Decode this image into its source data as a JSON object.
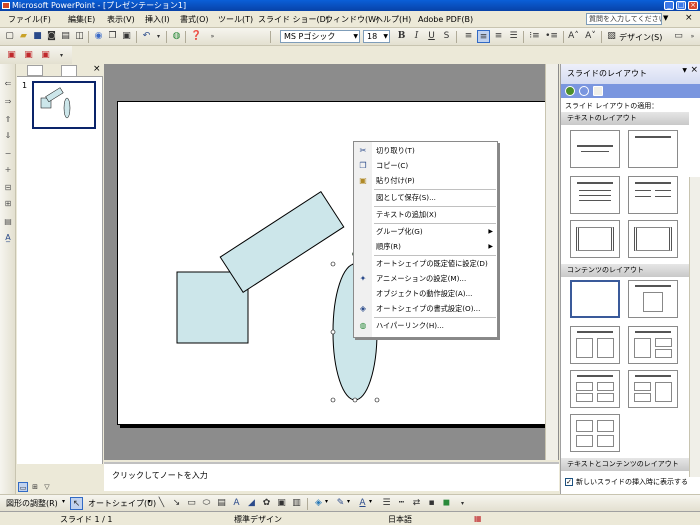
{
  "window": {
    "title": "Microsoft PowerPoint - [プレゼンテーション1]"
  },
  "menu": {
    "items": [
      "ファイル(F)",
      "編集(E)",
      "表示(V)",
      "挿入(I)",
      "書式(O)",
      "ツール(T)",
      "スライド ショー(D)",
      "ウィンドウ(W)",
      "ヘルプ(H)",
      "Adobe PDF(B)"
    ],
    "help_placeholder": "質問を入力してください"
  },
  "format_toolbar": {
    "font": "MS Pゴシック",
    "size": "18",
    "bold": "B",
    "italic": "I",
    "underline": "U",
    "shadow": "S",
    "design_label": "デザイン(S)"
  },
  "outline": {
    "slide_number": "1"
  },
  "notes": {
    "placeholder": "クリックしてノートを入力"
  },
  "context_menu": {
    "cut": "切り取り(T)",
    "copy": "コピー(C)",
    "paste": "貼り付け(P)",
    "save_as_picture": "図として保存(S)...",
    "add_text": "テキストの追加(X)",
    "grouping": "グループ化(G)",
    "order": "順序(R)",
    "set_default": "オートシェイプの既定値に設定(D)",
    "animation": "アニメーションの設定(M)...",
    "action_settings": "オブジェクトの動作設定(A)...",
    "format_autoshape": "オートシェイプの書式設定(O)...",
    "hyperlink": "ハイパーリンク(H)..."
  },
  "task_pane": {
    "title": "スライドのレイアウト",
    "subtitle": "スライド レイアウトの適用：",
    "section_text": "テキストのレイアウト",
    "section_content": "コンテンツのレイアウト",
    "section_text_content": "テキストとコンテンツのレイアウト",
    "show_on_insert": "新しいスライドの挿入時に表示する",
    "show_on_insert_checked": true
  },
  "drawing_toolbar": {
    "draw_label": "図形の調整(R)",
    "autoshape_label": "オートシェイプ(U)"
  },
  "status": {
    "slide": "スライド 1 / 1",
    "design": "標準デザイン",
    "language": "日本語"
  },
  "colors": {
    "shape_fill": "#cce6ea",
    "title_bar": "#0a5fd8"
  }
}
